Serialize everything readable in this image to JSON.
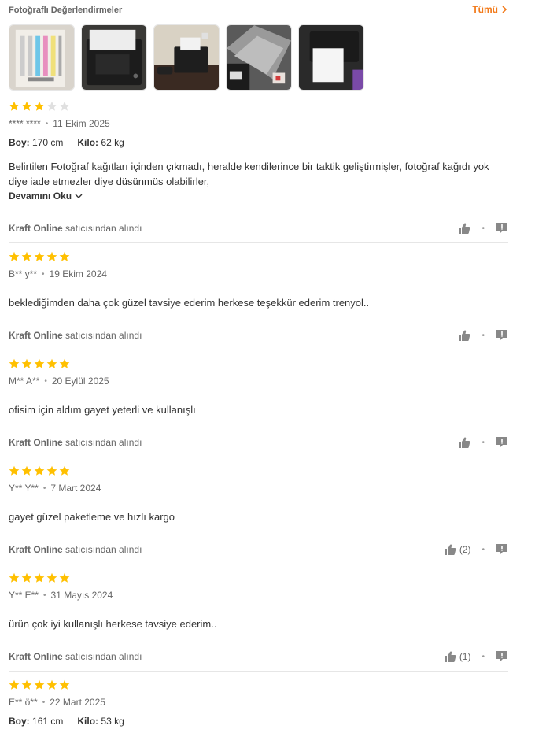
{
  "header": {
    "title": "Fotoğraflı Değerlendirmeler",
    "all_label": "Tümü"
  },
  "photos": [
    {
      "name": "photo-color-test-print"
    },
    {
      "name": "photo-printer-top"
    },
    {
      "name": "photo-printer-desk"
    },
    {
      "name": "photo-printer-laptop"
    },
    {
      "name": "photo-printer-paper"
    }
  ],
  "colors": {
    "accent": "#f27a1a",
    "star": "#ffc000",
    "star_empty": "#e0e0e0"
  },
  "reviews": [
    {
      "rating": 3,
      "user": "**** ****",
      "date": "11 Ekim 2025",
      "height_label": "Boy:",
      "height": "170 cm",
      "weight_label": "Kilo:",
      "weight": "62 kg",
      "text": "Belirtilen Fotoğraf kağıtları içinden çıkmadı, heralde kendilerince bir taktik geliştirmişler, fotoğraf kağıdı yok diye iade etmezler diye düsünmüs olabilirler,",
      "more": "Devamını Oku",
      "seller": "Kraft Online",
      "seller_suffix": "satıcısından alındı",
      "likes": ""
    },
    {
      "rating": 5,
      "user": "B** y**",
      "date": "19 Ekim 2024",
      "text": "beklediğimden daha çok güzel tavsiye ederim herkese teşekkür ederim trenyol..",
      "seller": "Kraft Online",
      "seller_suffix": "satıcısından alındı",
      "likes": ""
    },
    {
      "rating": 5,
      "user": "M** A**",
      "date": "20 Eylül 2025",
      "text": "ofisim için aldım gayet yeterli ve kullanışlı",
      "seller": "Kraft Online",
      "seller_suffix": "satıcısından alındı",
      "likes": ""
    },
    {
      "rating": 5,
      "user": "Y** Y**",
      "date": "7 Mart 2024",
      "text": "gayet güzel paketleme ve hızlı kargo",
      "seller": "Kraft Online",
      "seller_suffix": "satıcısından alındı",
      "likes": "(2)"
    },
    {
      "rating": 5,
      "user": "Y** E**",
      "date": "31 Mayıs 2024",
      "text": "ürün çok iyi kullanışlı herkese tavsiye ederim..",
      "seller": "Kraft Online",
      "seller_suffix": "satıcısından alındı",
      "likes": "(1)"
    },
    {
      "rating": 5,
      "user": "E** ö**",
      "date": "22 Mart 2025",
      "height_label": "Boy:",
      "height": "161 cm",
      "weight_label": "Kilo:",
      "weight": "53 kg"
    }
  ]
}
